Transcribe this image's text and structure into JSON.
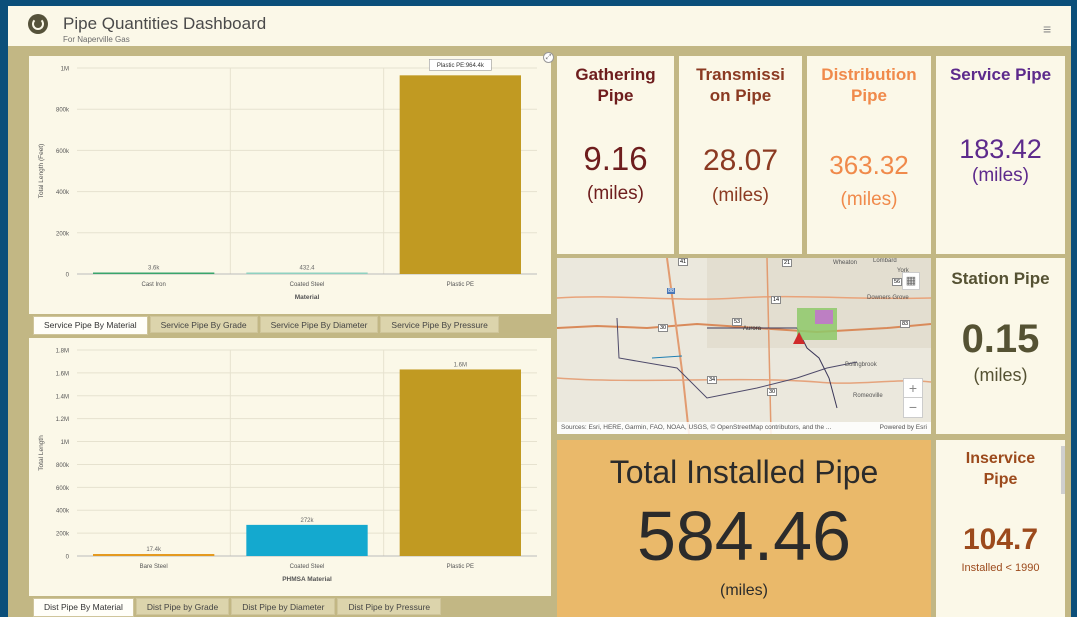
{
  "header": {
    "title": "Pipe Quantities Dashboard",
    "subtitle": "For Naperville Gas"
  },
  "service_chart": {
    "tabs": [
      "Service Pipe By Material",
      "Service Pipe By Grade",
      "Service Pipe By Diameter",
      "Service Pipe By Pressure"
    ],
    "active_tab": 0,
    "tooltip": "Plastic PE:964.4k"
  },
  "dist_chart": {
    "tabs": [
      "Dist Pipe By Material",
      "Dist Pipe by Grade",
      "Dist Pipe by Diameter",
      "Dist Pipe by Pressure"
    ],
    "active_tab": 0
  },
  "chart_data": [
    {
      "type": "bar",
      "categories": [
        "Cast Iron",
        "Coated Steel",
        "Plastic PE"
      ],
      "values": [
        3600,
        432.4,
        964400
      ],
      "data_labels": [
        "3.6k",
        "432.4",
        ""
      ],
      "colors": [
        "#3aa56b",
        "#8fd1c0",
        "#c19a22"
      ],
      "xlabel": "Material",
      "ylabel": "Total Length (Feet)",
      "ylim": [
        0,
        1000000
      ],
      "yticks": [
        0,
        200000,
        400000,
        600000,
        800000,
        1000000
      ],
      "ytick_labels": [
        "0",
        "200k",
        "400k",
        "600k",
        "800k",
        "1M"
      ],
      "grid": true
    },
    {
      "type": "bar",
      "categories": [
        "Bare Steel",
        "Coated Steel",
        "Plastic PE"
      ],
      "values": [
        17400,
        272000,
        1630000
      ],
      "data_labels": [
        "17.4k",
        "272k",
        "1.6M"
      ],
      "colors": [
        "#e49a1f",
        "#14a9cf",
        "#c19a22"
      ],
      "xlabel": "PHMSA Material",
      "ylabel": "Total Length",
      "ylim": [
        0,
        1800000
      ],
      "yticks": [
        0,
        200000,
        400000,
        600000,
        800000,
        1000000,
        1200000,
        1400000,
        1600000,
        1800000
      ],
      "ytick_labels": [
        "0",
        "200k",
        "400k",
        "600k",
        "800k",
        "1M",
        "1.2M",
        "1.4M",
        "1.6M",
        "1.8M"
      ],
      "grid": true
    }
  ],
  "cards": [
    {
      "title": "Gathering Pipe",
      "value": "9.16",
      "unit": "(miles)",
      "color": "#6e1d1d"
    },
    {
      "title": "Transmission Pipe",
      "value": "28.07",
      "unit": "(miles)",
      "color": "#8b3a22"
    },
    {
      "title": "Distribution Pipe",
      "value": "363.32",
      "unit": "(miles)",
      "color": "#f08a4b"
    },
    {
      "title": "Service Pipe",
      "value": "183.42",
      "unit": "(miles)",
      "color": "#5d2a8c"
    },
    {
      "title": "Station Pipe",
      "value": "0.15",
      "unit": "(miles)",
      "color": "#555233"
    },
    {
      "title": "Inservice Pipe",
      "value": "104.7",
      "unit": "Installed < 1990",
      "color": "#9c4a1c"
    }
  ],
  "total": {
    "title": "Total Installed Pipe",
    "value": "584.46",
    "unit": "(miles)"
  },
  "map": {
    "attribution": "Sources: Esri, HERE, Garmin, FAO, NOAA, USGS, © OpenStreetMap contributors, and the ...",
    "powered_by": "Powered by Esri",
    "labels": [
      "Wheaton",
      "Lombard",
      "York",
      "Downers Grove",
      "Aurora",
      "Bolingbrook",
      "Romeoville"
    ],
    "route_shields": [
      "41",
      "21",
      "56",
      "14",
      "88",
      "30",
      "53",
      "34",
      "30",
      "83"
    ]
  }
}
